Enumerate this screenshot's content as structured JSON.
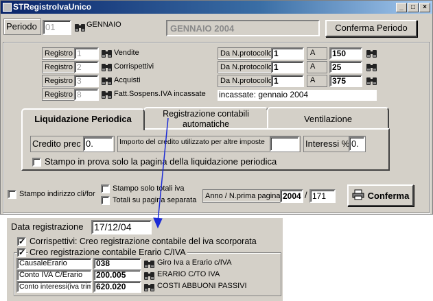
{
  "window": {
    "title": "STRegistroIvaUnico",
    "min": "_",
    "max": "□",
    "close": "×"
  },
  "periodo": {
    "label": "Periodo",
    "code": "01",
    "month": "GENNAIO",
    "display": "GENNAIO 2004",
    "confirm_label": "Conferma Periodo"
  },
  "registri": [
    {
      "label": "Registro",
      "num": "1",
      "desc": "Vendite",
      "prot_label": "Da N.protocollo",
      "from": "1",
      "a_label": "A",
      "to": "150"
    },
    {
      "label": "Registro",
      "num": "2",
      "desc": "Corrispettivi",
      "prot_label": "Da N.protocollo",
      "from": "1",
      "a_label": "A",
      "to": "25"
    },
    {
      "label": "Registro",
      "num": "3",
      "desc": "Acquisti",
      "prot_label": "Da N.protocollo",
      "from": "1",
      "a_label": "A",
      "to": "375"
    },
    {
      "label": "Registro",
      "num": "8",
      "desc": "Fatt.Sospens.IVA incassate",
      "note": "incassate: gennaio 2004"
    }
  ],
  "tabs": [
    {
      "label": "Liquidazione Periodica"
    },
    {
      "label": "Registrazione contabili automatiche"
    },
    {
      "label": "Ventilazione"
    }
  ],
  "liquidazione": {
    "credito_label": "Credito prec",
    "credito_value": "0.",
    "importo_label": "Importo del credito utilizzato per altre imposte",
    "importo_value": "",
    "interessi_label": "Interessi %",
    "interessi_value": "0.",
    "stampo_prova": "Stampo in prova solo la pagina della liquidazione periodica"
  },
  "options": {
    "indirizzo": "Stampo indirizzo cli/for",
    "totali_iva": "Stampo solo totali iva",
    "totali_pagina": "Totali su pagina separata",
    "anno_label": "Anno / N.prima pagina",
    "anno": "2004",
    "slash": "/",
    "pagina": "171",
    "confirm_label": "Conferma"
  },
  "registrazione": {
    "data_label": "Data registrazione",
    "data_value": "17/12/04",
    "corrispettivi": "Corrispettivi: Creo registrazione contabile del iva scorporata",
    "erario": "Creo registrazione contabile Erario C/IVA",
    "rows": [
      {
        "label": "CausaleErario",
        "value": "038",
        "desc": "Giro Iva a Erario c/IVA"
      },
      {
        "label": "Conto IVA C/Erario",
        "value": "200.005",
        "desc": "ERARIO C/TO IVA"
      },
      {
        "label": "Conto interessi(iva trim)",
        "value": "620.020",
        "desc": "COSTI ABBUONI PASSIVI"
      }
    ]
  },
  "colors": {
    "titlebar": "#0a246a",
    "face": "#d4d0c8",
    "arrow": "#1c2bd6"
  }
}
